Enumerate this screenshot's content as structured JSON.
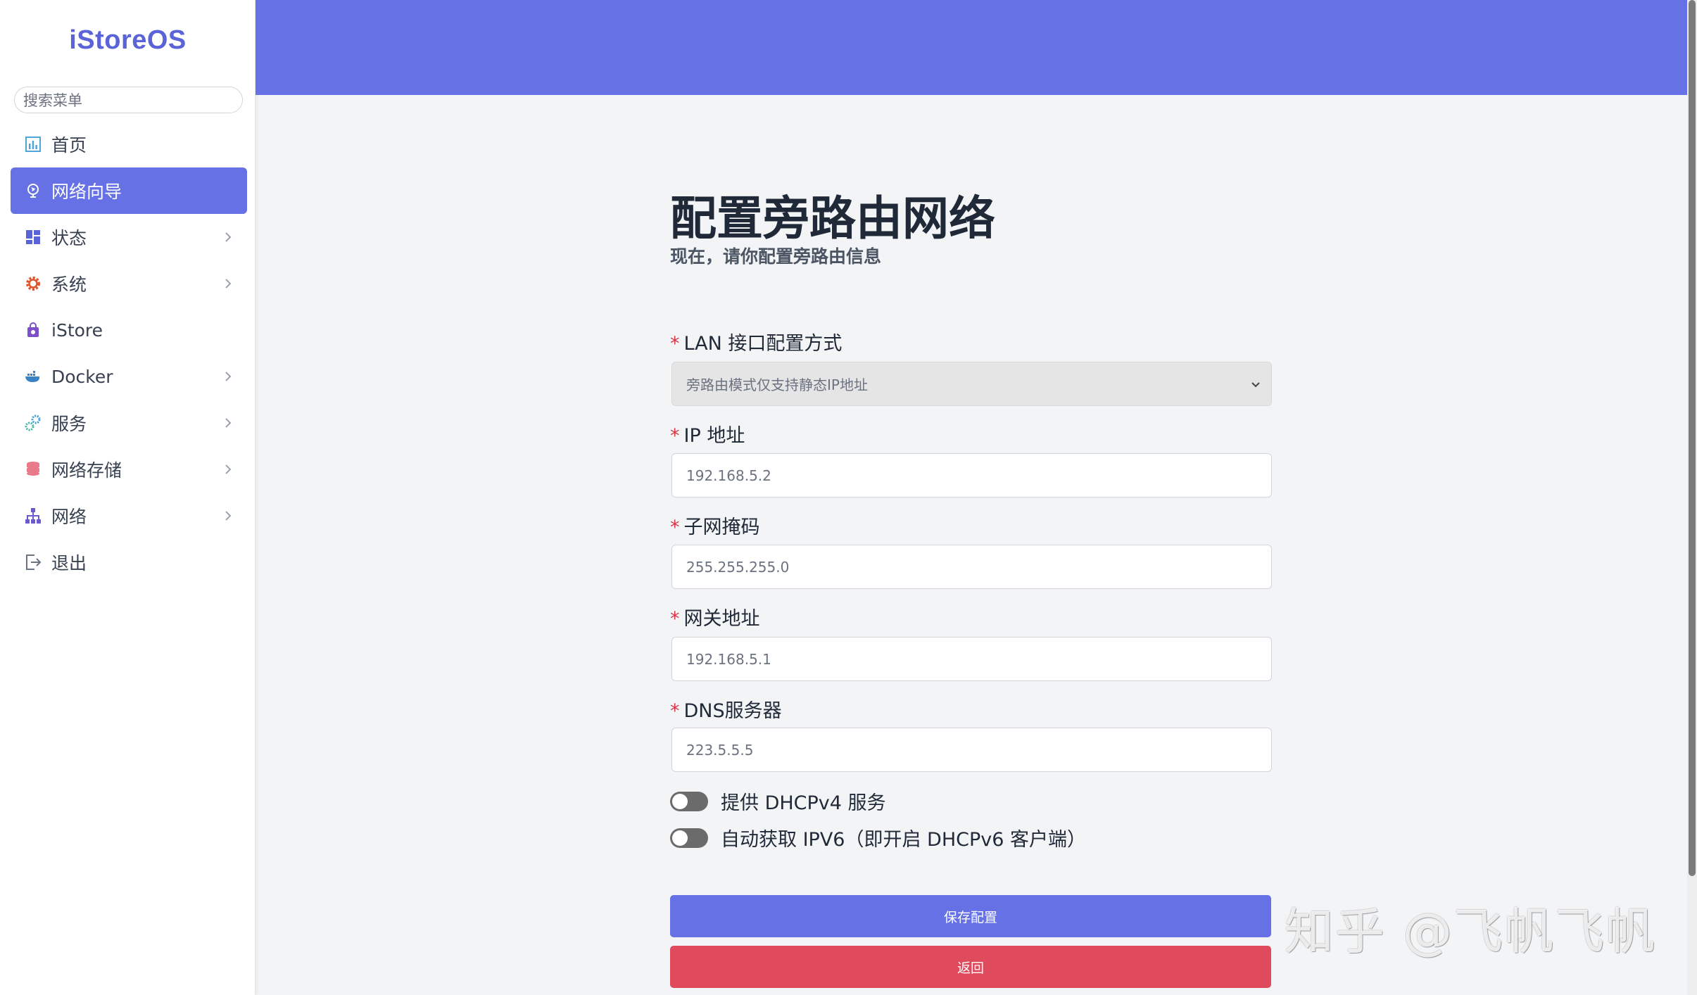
{
  "brand": {
    "logo_text": "iStoreOS"
  },
  "sidebar": {
    "search_placeholder": "搜索菜单",
    "items": [
      {
        "label": "首页",
        "icon": "chart-icon",
        "has_submenu": false,
        "active": false
      },
      {
        "label": "网络向导",
        "icon": "globe-icon",
        "has_submenu": false,
        "active": true
      },
      {
        "label": "状态",
        "icon": "dashboard-icon",
        "has_submenu": true,
        "active": false
      },
      {
        "label": "系统",
        "icon": "gear-icon",
        "has_submenu": true,
        "active": false
      },
      {
        "label": "iStore",
        "icon": "bag-icon",
        "has_submenu": false,
        "active": false
      },
      {
        "label": "Docker",
        "icon": "docker-icon",
        "has_submenu": true,
        "active": false
      },
      {
        "label": "服务",
        "icon": "cogs-icon",
        "has_submenu": true,
        "active": false
      },
      {
        "label": "网络存储",
        "icon": "database-icon",
        "has_submenu": true,
        "active": false
      },
      {
        "label": "网络",
        "icon": "network-icon",
        "has_submenu": true,
        "active": false
      },
      {
        "label": "退出",
        "icon": "logout-icon",
        "has_submenu": false,
        "active": false
      }
    ]
  },
  "page": {
    "title": "配置旁路由网络",
    "subtitle": "现在，请你配置旁路由信息"
  },
  "form": {
    "lan_mode": {
      "label": "LAN 接口配置方式",
      "value": "旁路由模式仅支持静态IP地址",
      "required": true
    },
    "ip": {
      "label": "IP 地址",
      "value": "192.168.5.2",
      "required": true
    },
    "netmask": {
      "label": "子网掩码",
      "value": "255.255.255.0",
      "required": true
    },
    "gateway": {
      "label": "网关地址",
      "value": "192.168.5.1",
      "required": true
    },
    "dns": {
      "label": "DNS服务器",
      "value": "223.5.5.5",
      "required": true
    },
    "dhcpv4_toggle": {
      "label": "提供 DHCPv4 服务",
      "enabled": false
    },
    "ipv6_toggle": {
      "label": "自动获取 IPV6（即开启 DHCPv6 客户端）",
      "enabled": false
    },
    "save_label": "保存配置",
    "back_label": "返回"
  },
  "watermark": {
    "text": "知乎 @飞帆飞帆"
  },
  "colors": {
    "accent": "#6571e5",
    "danger": "#df4a5d",
    "required": "#dc3545"
  }
}
